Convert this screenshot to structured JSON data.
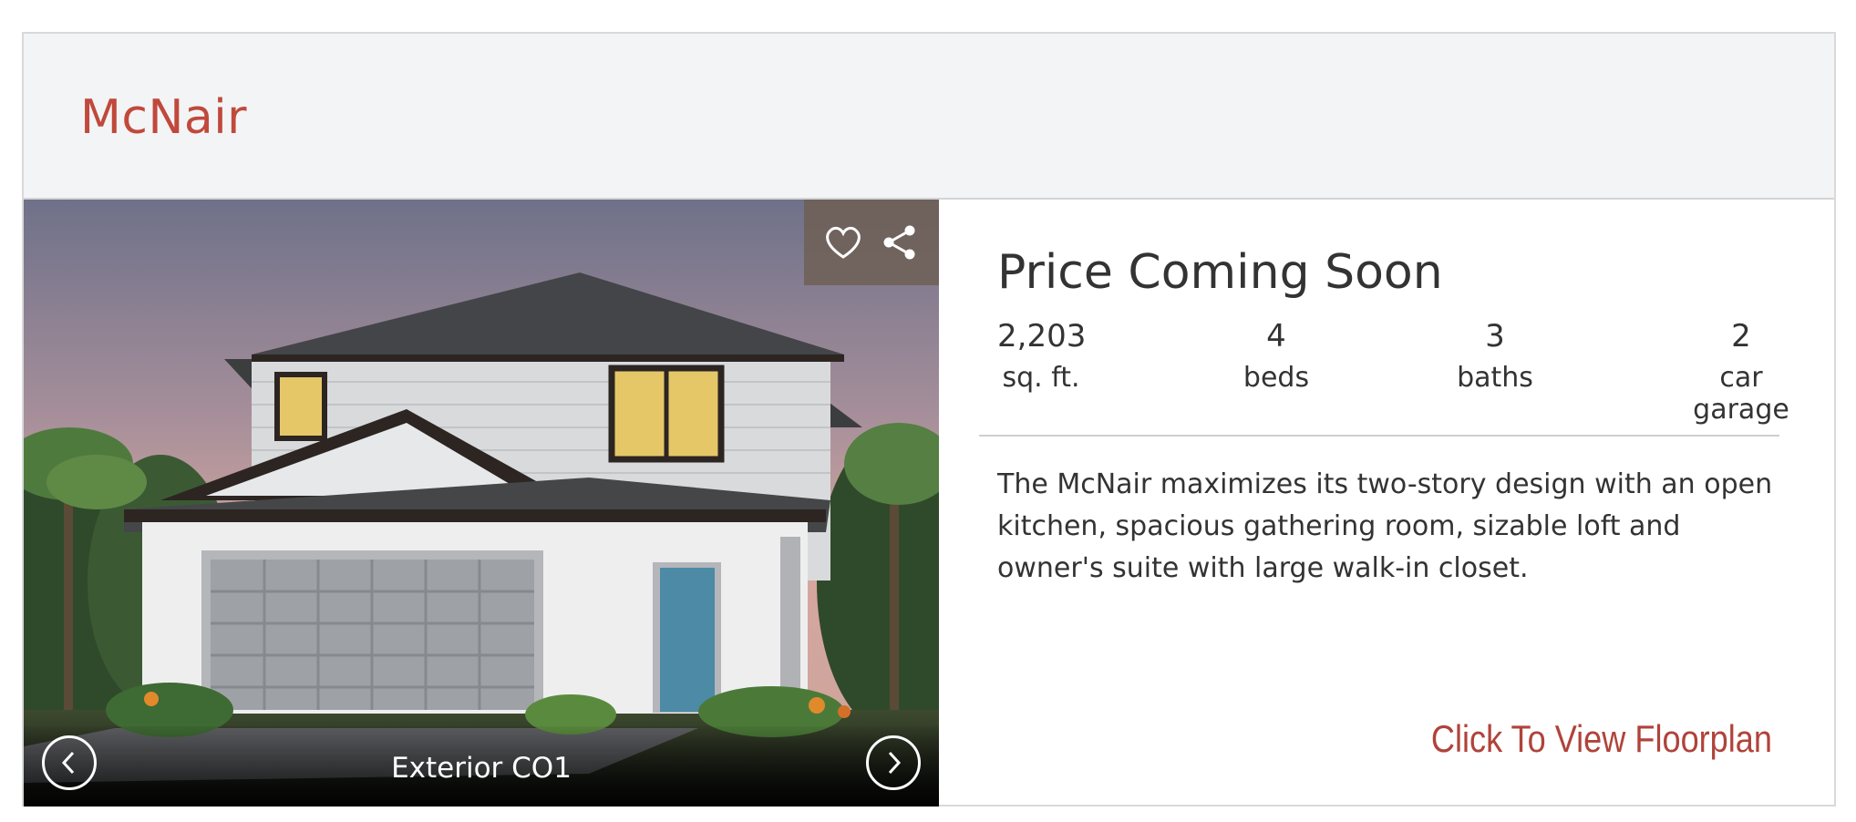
{
  "header": {
    "model_name": "McNair"
  },
  "gallery": {
    "caption": "Exterior CO1",
    "icons": {
      "favorite": "heart-icon",
      "share": "share-icon",
      "prev": "chevron-left-icon",
      "next": "chevron-right-icon"
    }
  },
  "details": {
    "price": "Price Coming Soon",
    "stats": [
      {
        "value": "2,203",
        "label": "sq. ft."
      },
      {
        "value": "4",
        "label": "beds"
      },
      {
        "value": "3",
        "label": "baths"
      },
      {
        "value": "2",
        "label": "car garage"
      }
    ],
    "description": "The McNair maximizes its two-story design with an open kitchen, spacious gathering room, sizable loft and owner's suite with large walk-in closet.",
    "floorplan_link": "Click To View Floorplan"
  },
  "colors": {
    "accent": "#c0493b",
    "header_bg": "#f3f4f6",
    "text": "#333333"
  }
}
